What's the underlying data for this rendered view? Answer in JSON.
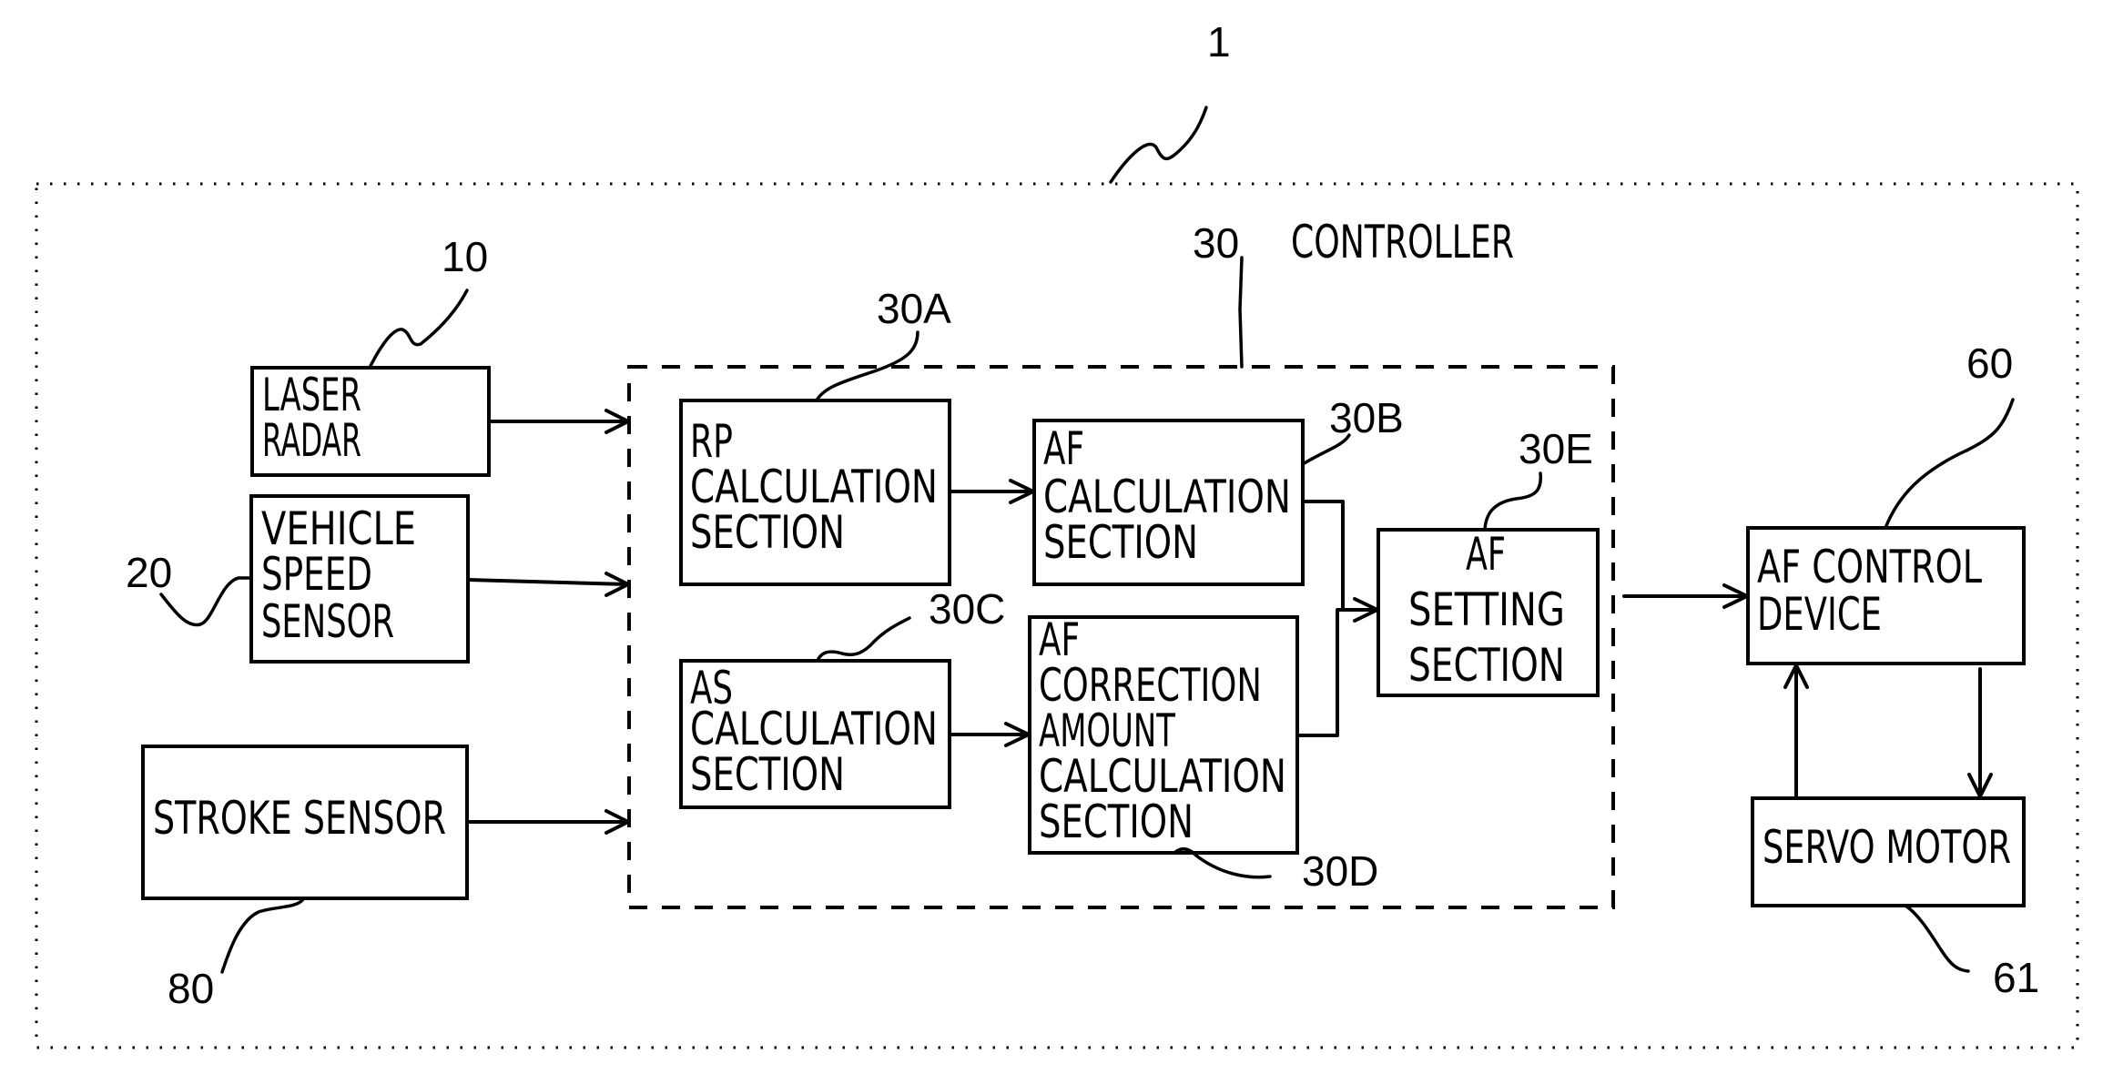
{
  "figure": {
    "system_ref": "1",
    "controller": {
      "ref": "30",
      "title": "CONTROLLER"
    }
  },
  "blocks": {
    "laser_radar": {
      "ref": "10",
      "lines": [
        "LASER",
        "RADAR"
      ]
    },
    "vehicle_speed": {
      "ref": "20",
      "lines": [
        "VEHICLE",
        "SPEED",
        "SENSOR"
      ]
    },
    "stroke_sensor": {
      "ref": "80",
      "lines": [
        "STROKE SENSOR"
      ]
    },
    "rp_calc": {
      "ref": "30A",
      "lines": [
        "RP",
        "CALCULATION",
        "SECTION"
      ]
    },
    "af_calc": {
      "ref": "30B",
      "lines": [
        "AF",
        "CALCULATION",
        "SECTION"
      ]
    },
    "as_calc": {
      "ref": "30C",
      "lines": [
        "AS",
        "CALCULATION",
        "SECTION"
      ]
    },
    "af_correction": {
      "ref": "30D",
      "lines": [
        "AF",
        "CORRECTION",
        "AMOUNT",
        "CALCULATION",
        "SECTION"
      ]
    },
    "af_setting": {
      "ref": "30E",
      "lines": [
        "AF",
        "SETTING",
        "SECTION"
      ]
    },
    "af_control": {
      "ref": "60",
      "lines": [
        "AF CONTROL",
        "DEVICE"
      ]
    },
    "servo_motor": {
      "ref": "61",
      "lines": [
        "SERVO MOTOR"
      ]
    }
  },
  "connections": [
    {
      "from": "LASER RADAR",
      "to": "CONTROLLER"
    },
    {
      "from": "VEHICLE SPEED SENSOR",
      "to": "CONTROLLER"
    },
    {
      "from": "STROKE SENSOR",
      "to": "CONTROLLER"
    },
    {
      "from": "RP CALCULATION SECTION",
      "to": "AF CALCULATION SECTION"
    },
    {
      "from": "AS CALCULATION SECTION",
      "to": "AF CORRECTION AMOUNT CALCULATION SECTION"
    },
    {
      "from": "AF CALCULATION SECTION",
      "to": "AF SETTING SECTION"
    },
    {
      "from": "AF CORRECTION AMOUNT CALCULATION SECTION",
      "to": "AF SETTING SECTION"
    },
    {
      "from": "CONTROLLER",
      "to": "AF CONTROL DEVICE"
    },
    {
      "from": "AF CONTROL DEVICE",
      "to": "SERVO MOTOR"
    },
    {
      "from": "SERVO MOTOR",
      "to": "AF CONTROL DEVICE"
    }
  ]
}
